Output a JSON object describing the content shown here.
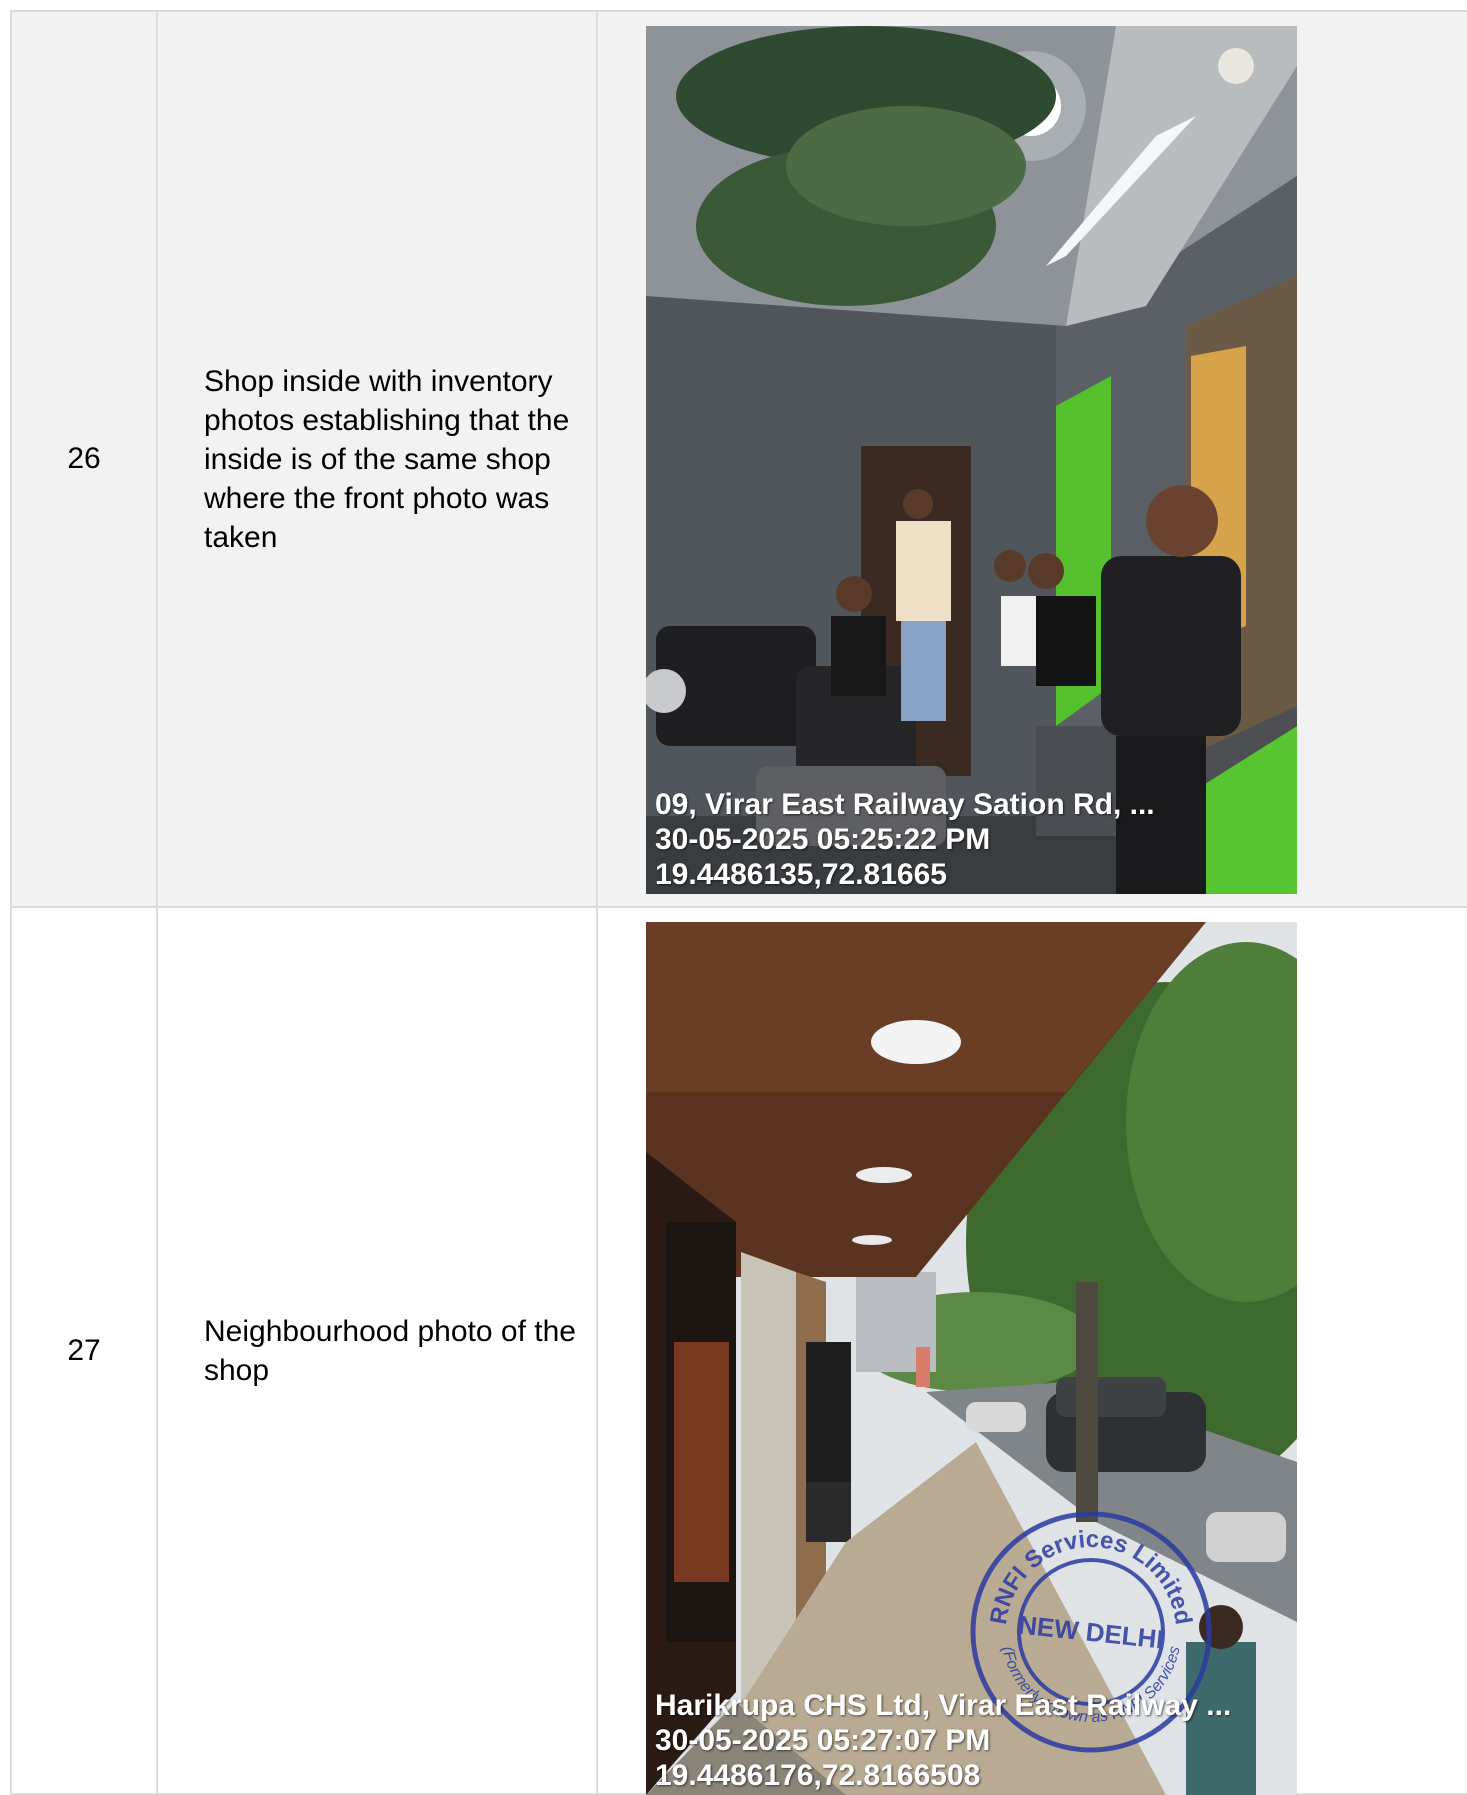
{
  "rows": [
    {
      "number": "26",
      "description": "Shop inside with inventory photos establishing that the inside is of the same shop where the front photo was taken",
      "photo": {
        "subject": "salon interior with people",
        "overlay": [
          "09, Virar East Railway Sation Rd, ...",
          "30-05-2025 05:25:22 PM",
          "19.4486135,72.81665"
        ]
      }
    },
    {
      "number": "27",
      "description": "Neighbourhood photo of the shop",
      "photo": {
        "subject": "street outside salon",
        "overlay": [
          "Harikrupa CHS Ltd, Virar East Railway ...",
          "30-05-2025 05:27:07 PM",
          "19.4486176,72.8166508"
        ],
        "stamp": {
          "top_text": "RNFI Services Limited",
          "center_text": "NEW DELHI",
          "side_text": "(Formerly Known as RNFI Services",
          "color": "#2b3aa0"
        }
      }
    }
  ],
  "colors": {
    "border": "#dcdcdc",
    "shaded_row": "#f2f2f2",
    "stamp": "#2b3aa0"
  }
}
